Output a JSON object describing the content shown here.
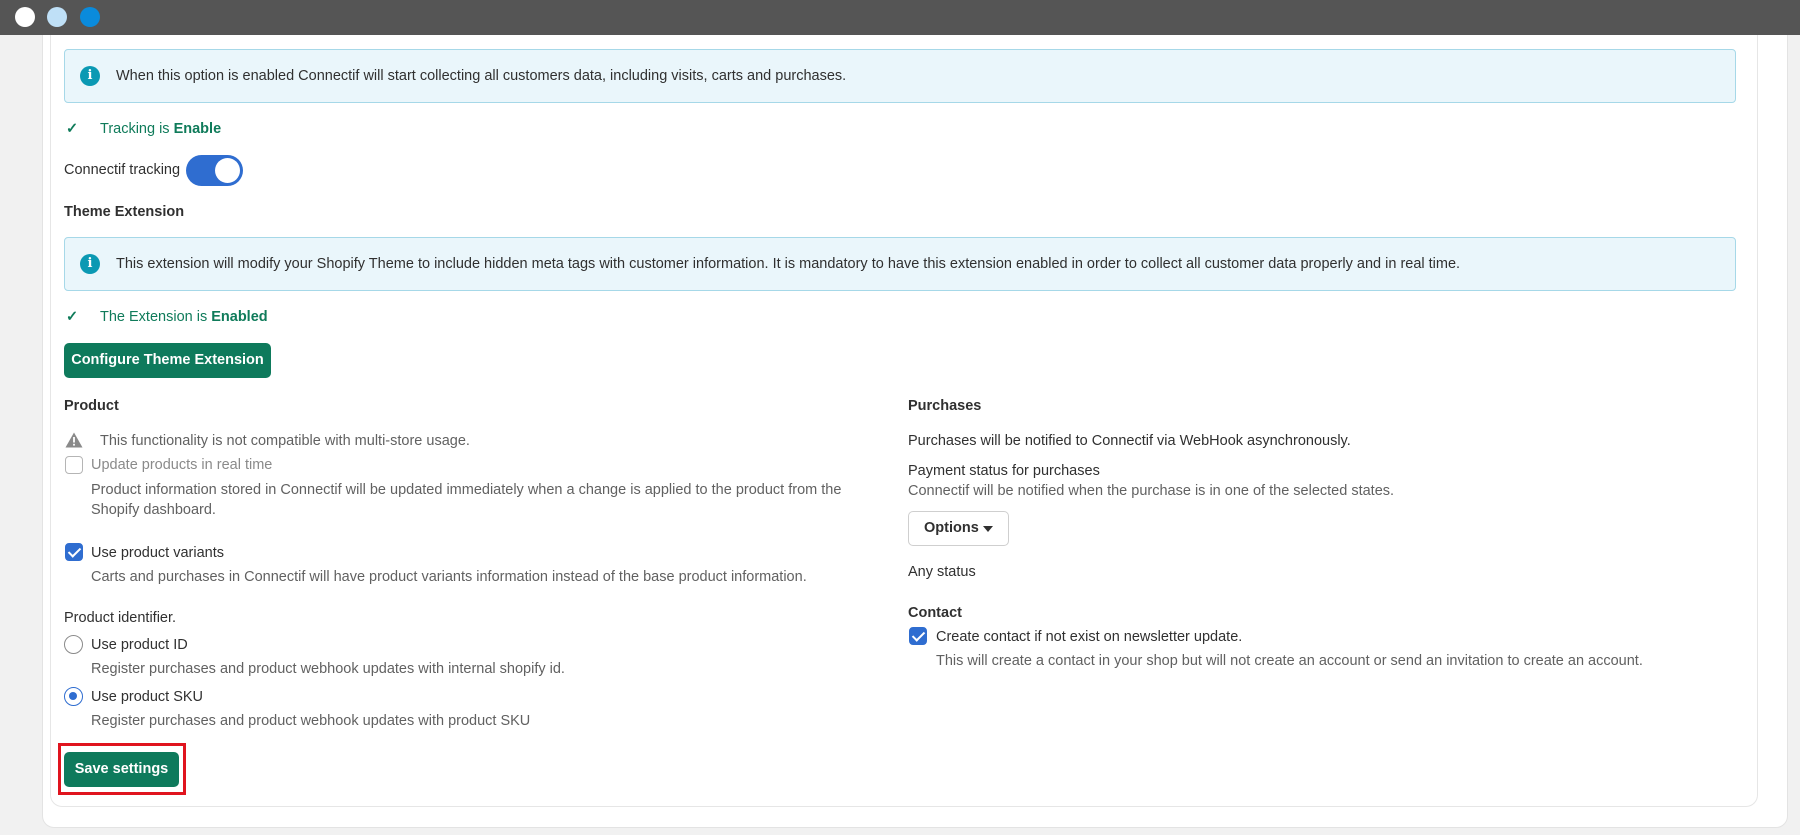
{
  "window": {
    "controls": [
      "close",
      "minimize",
      "maximize"
    ]
  },
  "tracking": {
    "info_text": "When this option is enabled Connectif will start collecting all customers data, including visits, carts and purchases.",
    "status_prefix": "Tracking is",
    "status_value": "Enable",
    "toggle_label": "Connectif tracking",
    "toggle_on": true
  },
  "theme_extension": {
    "heading": "Theme Extension",
    "info_text": "This extension will modify your Shopify Theme to include hidden meta tags with customer information. It is mandatory to have this extension enabled in order to collect all customer data properly and in real time.",
    "status_prefix": "The Extension is",
    "status_value": "Enabled",
    "configure_button": "Configure Theme Extension"
  },
  "product": {
    "heading": "Product",
    "warning": "This functionality is not compatible with multi-store usage.",
    "update_realtime": {
      "label": "Update products in real time",
      "checked": false,
      "disabled": true,
      "help": "Product information stored in Connectif will be updated immediately when a change is applied to the product from the Shopify dashboard."
    },
    "use_variants": {
      "label": "Use product variants",
      "checked": true,
      "help": "Carts and purchases in Connectif will have product variants information instead of the base product information."
    },
    "identifier": {
      "label": "Product identifier.",
      "options": [
        {
          "label": "Use product ID",
          "help": "Register purchases and product webhook updates with internal shopify id.",
          "selected": false
        },
        {
          "label": "Use product SKU",
          "help": "Register purchases and product webhook updates with product SKU",
          "selected": true
        }
      ]
    }
  },
  "purchases": {
    "heading": "Purchases",
    "description": "Purchases will be notified to Connectif via WebHook asynchronously.",
    "payment_status_label": "Payment status for purchases",
    "payment_status_help": "Connectif will be notified when the purchase is in one of the selected states.",
    "options_button": "Options",
    "selected_value": "Any status"
  },
  "contact": {
    "heading": "Contact",
    "create_contact": {
      "label": "Create contact if not exist on newsletter update.",
      "checked": true,
      "help": "This will create a contact in your shop but will not create an account or send an invitation to create an account."
    }
  },
  "save_button": "Save settings",
  "colors": {
    "primary_button": "#0e7a5c",
    "status_green": "#0f7b5a",
    "toggle_blue": "#2f6dd0",
    "info_bg": "#eaf6fb",
    "info_border": "#a6d8e8",
    "info_icon": "#0b99b3",
    "highlight": "#e0141e"
  }
}
